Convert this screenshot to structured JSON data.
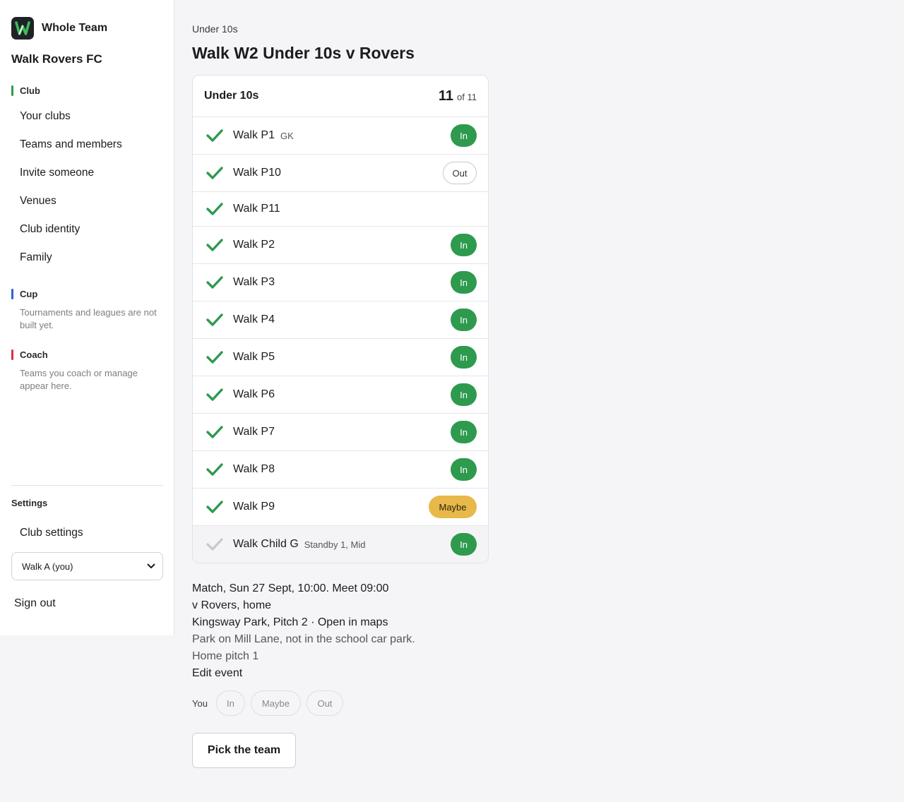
{
  "brand": {
    "name": "Whole Team",
    "logo_letter": "W"
  },
  "club_name": "Walk Rovers FC",
  "colors": {
    "club": "#2e9a4e",
    "cup": "#2f5fd8",
    "coach": "#d8323f",
    "in": "#2e9a4e",
    "maybe": "#e8b84a"
  },
  "sidebar": {
    "club_label": "Club",
    "club_items": [
      "Your clubs",
      "Teams and members",
      "Invite someone",
      "Venues",
      "Club identity",
      "Family"
    ],
    "cup_label": "Cup",
    "cup_note": "Tournaments and leagues are not built yet.",
    "coach_label": "Coach",
    "coach_note": "Teams you coach or manage appear here.",
    "settings_label": "Settings",
    "settings_item": "Club settings",
    "user_select": "Walk A (you)",
    "sign_out": "Sign out"
  },
  "main": {
    "breadcrumb": "Under 10s",
    "title": "Walk W2 Under 10s v Rovers",
    "card": {
      "title": "Under 10s",
      "count": "11",
      "count_total": "of 11",
      "players": [
        {
          "name": "Walk P1",
          "tag": "GK",
          "status": "In",
          "style": "in",
          "checked": true
        },
        {
          "name": "Walk P10",
          "tag": "",
          "status": "Out",
          "style": "out",
          "checked": true
        },
        {
          "name": "Walk P11",
          "tag": "",
          "status": "",
          "style": "",
          "checked": true
        },
        {
          "name": "Walk P2",
          "tag": "",
          "status": "In",
          "style": "in",
          "checked": true
        },
        {
          "name": "Walk P3",
          "tag": "",
          "status": "In",
          "style": "in",
          "checked": true
        },
        {
          "name": "Walk P4",
          "tag": "",
          "status": "In",
          "style": "in",
          "checked": true
        },
        {
          "name": "Walk P5",
          "tag": "",
          "status": "In",
          "style": "in",
          "checked": true
        },
        {
          "name": "Walk P6",
          "tag": "",
          "status": "In",
          "style": "in",
          "checked": true
        },
        {
          "name": "Walk P7",
          "tag": "",
          "status": "In",
          "style": "in",
          "checked": true
        },
        {
          "name": "Walk P8",
          "tag": "",
          "status": "In",
          "style": "in",
          "checked": true
        },
        {
          "name": "Walk P9",
          "tag": "",
          "status": "Maybe",
          "style": "maybe",
          "checked": true
        },
        {
          "name": "Walk Child G",
          "tag": "Standby 1, Mid",
          "status": "In",
          "style": "in",
          "checked": false
        }
      ]
    },
    "details": {
      "when": "Match, Sun 27 Sept, 10:00. Meet 09:00",
      "opponent": "v Rovers, home",
      "venue": "Kingsway Park, Pitch 2 · Open in maps",
      "parking": "Park on Mill Lane, not in the school car park.",
      "pitch": "Home pitch 1",
      "edit": "Edit event"
    },
    "you": {
      "label": "You",
      "options": [
        "In",
        "Maybe",
        "Out"
      ]
    },
    "pick_button": "Pick the team"
  }
}
